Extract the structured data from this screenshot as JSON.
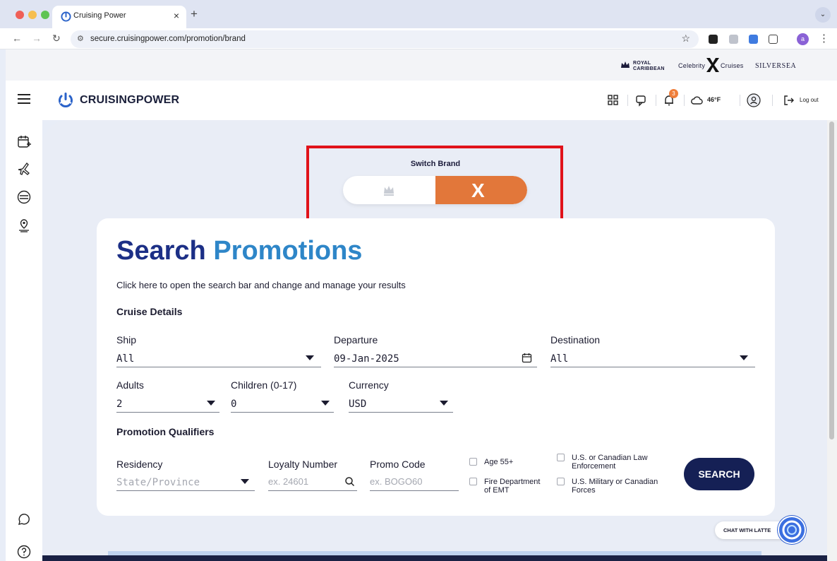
{
  "browser": {
    "tab_title": "Cruising Power",
    "tab_close": "×",
    "new_tab": "+",
    "tab_menu": "⌄",
    "url": "secure.cruisingpower.com/promotion/brand",
    "profile_initial": "a"
  },
  "brand_strip": {
    "royal_caribbean": "ROYAL CARIBBEAN",
    "celebrity_left": "Celebrity",
    "celebrity_right": "Cruises",
    "silversea": "SILVERSEA"
  },
  "header": {
    "logo_text": "CRUISINGPOWER",
    "notification_count": "3",
    "temperature": "46°F",
    "logout_label": "Log out"
  },
  "brand_switch": {
    "label": "Switch Brand",
    "right_glyph": "X"
  },
  "search": {
    "title_part1": "Search",
    "title_part2": "Promotions",
    "subtitle": "Click here to open the search bar and change and manage your results",
    "cruise_details_heading": "Cruise Details",
    "ship_label": "Ship",
    "ship_value": "All",
    "departure_label": "Departure",
    "departure_value": "09-Jan-2025",
    "destination_label": "Destination",
    "destination_value": "All",
    "adults_label": "Adults",
    "adults_value": "2",
    "children_label": "Children (0-17)",
    "children_value": "0",
    "currency_label": "Currency",
    "currency_value": "USD",
    "qualifiers_heading": "Promotion Qualifiers",
    "residency_label": "Residency",
    "residency_placeholder": "State/Province",
    "loyalty_label": "Loyalty Number",
    "loyalty_placeholder": "ex. 24601",
    "promo_label": "Promo Code",
    "promo_placeholder": "ex. BOGO60",
    "age55": "Age 55+",
    "fire_line1": "Fire Department",
    "fire_line2": "of EMT",
    "law_line1": "U.S. or Canadian Law",
    "law_line2": "Enforcement",
    "military_line1": "U.S. Military or Canadian",
    "military_line2": "Forces",
    "search_button": "SEARCH"
  },
  "chat": {
    "label": "CHAT WITH LATTE"
  },
  "colors": {
    "accent_orange": "#e2773a",
    "navy": "#152055",
    "title_blue": "#1c2f86",
    "title_teal": "#2e86c8",
    "highlight_red": "#e0121a"
  }
}
